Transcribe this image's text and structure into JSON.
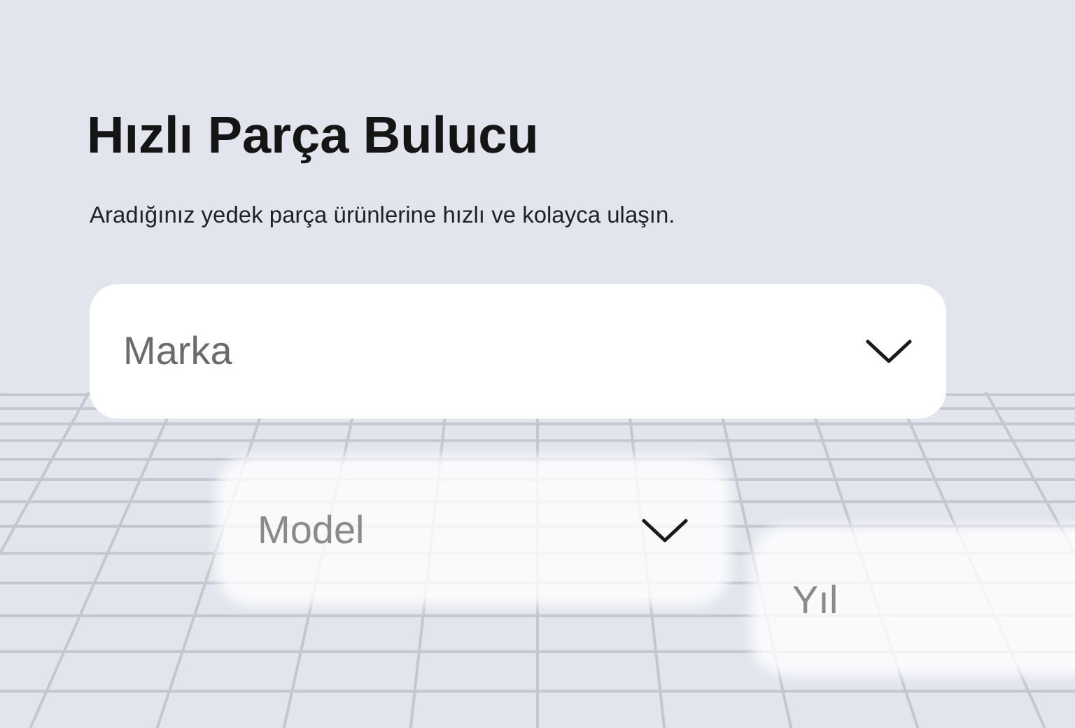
{
  "title": "Hızlı Parça Bulucu",
  "subtitle": "Aradığınız yedek parça ürünlerine hızlı ve kolayca ulaşın.",
  "selects": [
    {
      "placeholder": "Marka",
      "blurred": false,
      "caret": true
    },
    {
      "placeholder": "Model",
      "blurred": true,
      "caret": true
    },
    {
      "placeholder": "Yıl",
      "blurred": true,
      "caret": false
    }
  ]
}
